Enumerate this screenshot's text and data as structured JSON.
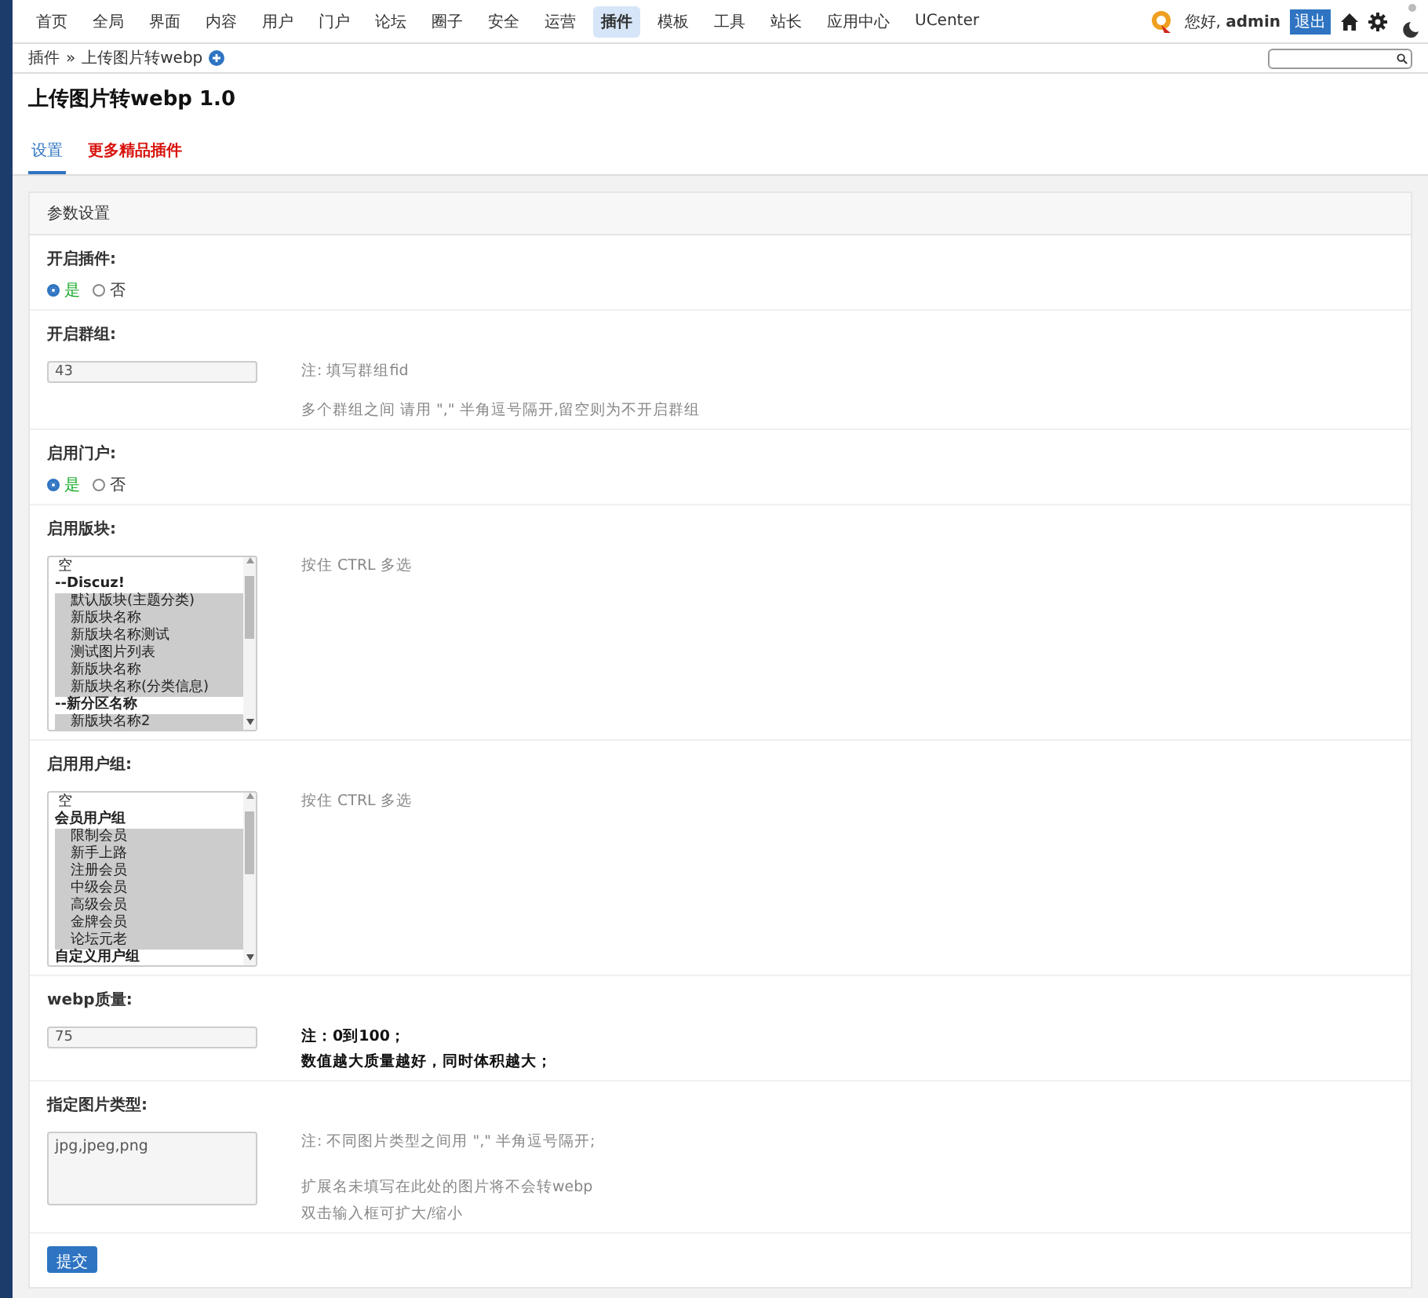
{
  "nav": {
    "items": [
      {
        "label": "首页",
        "selected": false
      },
      {
        "label": "全局",
        "selected": false
      },
      {
        "label": "界面",
        "selected": false
      },
      {
        "label": "内容",
        "selected": false
      },
      {
        "label": "用户",
        "selected": false
      },
      {
        "label": "门户",
        "selected": false
      },
      {
        "label": "论坛",
        "selected": false
      },
      {
        "label": "圈子",
        "selected": false
      },
      {
        "label": "安全",
        "selected": false
      },
      {
        "label": "运营",
        "selected": false
      },
      {
        "label": "插件",
        "selected": true
      },
      {
        "label": "模板",
        "selected": false
      },
      {
        "label": "工具",
        "selected": false
      },
      {
        "label": "站长",
        "selected": false
      },
      {
        "label": "应用中心",
        "selected": false
      },
      {
        "label": "UCenter",
        "selected": false
      }
    ],
    "greeting": "您好, **admin**",
    "logout": "退出"
  },
  "breadcrumb": {
    "parent": "插件",
    "separator": "»",
    "current": "上传图片转webp"
  },
  "title": "上传图片转webp 1.0",
  "tabs": [
    {
      "label": "设置",
      "selected": true,
      "kind": "normal"
    },
    {
      "label": "更多精品插件",
      "selected": false,
      "kind": "promo"
    }
  ],
  "card": {
    "title": "参数设置",
    "rows": [
      {
        "kind": "radio",
        "label": "开启插件:",
        "options": [
          {
            "label": "是",
            "selected": true
          },
          {
            "label": "否",
            "selected": false
          }
        ]
      },
      {
        "kind": "text",
        "label": "开启群组:",
        "value": "43",
        "notes": [
          {
            "text": "注: 填写群组fid",
            "bold": false
          },
          {
            "text": "多个群组之间 请用 \",\" 半角逗号隔开,留空则为不开启群组",
            "bold": false
          }
        ]
      },
      {
        "kind": "radio",
        "label": "启用门户:",
        "options": [
          {
            "label": "是",
            "selected": true
          },
          {
            "label": "否",
            "selected": false
          }
        ]
      },
      {
        "kind": "select",
        "label": "启用版块:",
        "notes": [
          {
            "text": "按住 CTRL 多选",
            "bold": false
          }
        ],
        "options": [
          {
            "label": "空",
            "group": false,
            "selected": false
          },
          {
            "label": "--Discuz!",
            "group": true,
            "selected": false
          },
          {
            "label": "默认版块(主题分类)",
            "group": false,
            "selected": true
          },
          {
            "label": "新版块名称",
            "group": false,
            "selected": true
          },
          {
            "label": "新版块名称测试",
            "group": false,
            "selected": true
          },
          {
            "label": "测试图片列表",
            "group": false,
            "selected": true
          },
          {
            "label": "新版块名称",
            "group": false,
            "selected": true
          },
          {
            "label": "新版块名称(分类信息)",
            "group": false,
            "selected": true
          },
          {
            "label": "--新分区名称",
            "group": true,
            "selected": false
          },
          {
            "label": "新版块名称2",
            "group": false,
            "selected": true
          }
        ]
      },
      {
        "kind": "select",
        "label": "启用用户组:",
        "notes": [
          {
            "text": "按住 CTRL 多选",
            "bold": false
          }
        ],
        "options": [
          {
            "label": "空",
            "group": false,
            "selected": false
          },
          {
            "label": "会员用户组",
            "group": true,
            "selected": false
          },
          {
            "label": "限制会员",
            "group": false,
            "selected": true
          },
          {
            "label": "新手上路",
            "group": false,
            "selected": true
          },
          {
            "label": "注册会员",
            "group": false,
            "selected": true
          },
          {
            "label": "中级会员",
            "group": false,
            "selected": true
          },
          {
            "label": "高级会员",
            "group": false,
            "selected": true
          },
          {
            "label": "金牌会员",
            "group": false,
            "selected": true
          },
          {
            "label": "论坛元老",
            "group": false,
            "selected": true
          },
          {
            "label": "自定义用户组",
            "group": true,
            "selected": false
          }
        ]
      },
      {
        "kind": "text",
        "label": "webp质量:",
        "value": "75",
        "notes": [
          {
            "text": "注：0到100；",
            "bold": true
          },
          {
            "text": "数值越大质量越好，同时体积越大；",
            "bold": true
          }
        ]
      },
      {
        "kind": "textarea",
        "label": "指定图片类型:",
        "value": "jpg,jpeg,png",
        "notes": [
          {
            "text": "注: 不同图片类型之间用 \",\" 半角逗号隔开;",
            "bold": false
          },
          {
            "text": "扩展名未填写在此处的图片将不会转webp",
            "bold": false
          },
          {
            "text": "双击输入框可扩大/缩小",
            "bold": false
          }
        ]
      }
    ],
    "submit": "提交"
  }
}
